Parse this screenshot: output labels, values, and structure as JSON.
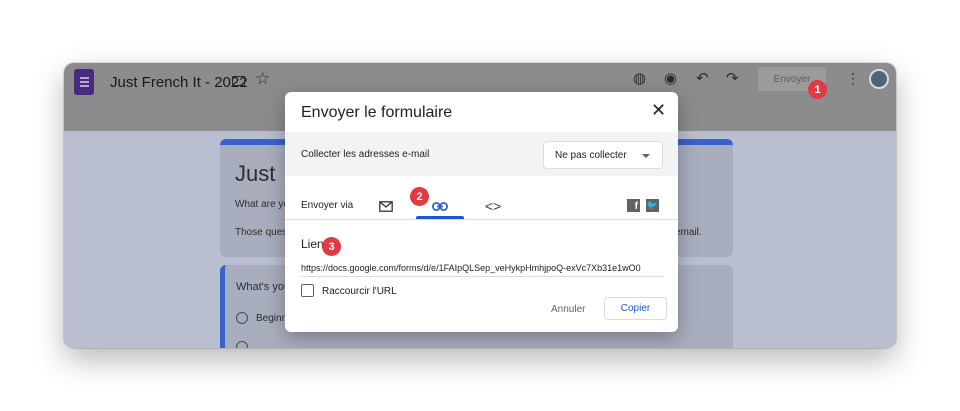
{
  "app": {
    "title": "Just French It - 2022",
    "send_label": "Envoyer"
  },
  "background_form": {
    "card1_title": "Just",
    "card1_line1": "What are yo",
    "card1_line2": "Those ques",
    "card1_line2_end": "email.",
    "card2_question": "What's you",
    "card2_option": "Beginn"
  },
  "dialog": {
    "title": "Envoyer le formulaire",
    "collect_label": "Collecter les adresses e-mail",
    "collect_value": "Ne pas collecter",
    "via_label": "Envoyer via",
    "link_label": "Lien",
    "url": "https://docs.google.com/forms/d/e/1FAIpQLSep_veHykpHmhjpoQ-exVc7Xb31e1wO0",
    "shorten_label": "Raccourcir l'URL",
    "cancel_label": "Annuler",
    "copy_label": "Copier"
  },
  "annotations": [
    "1",
    "2",
    "3"
  ],
  "colors": {
    "accent": "#1a56d6",
    "badge": "#e23a43",
    "form_accent": "#3863c9"
  }
}
